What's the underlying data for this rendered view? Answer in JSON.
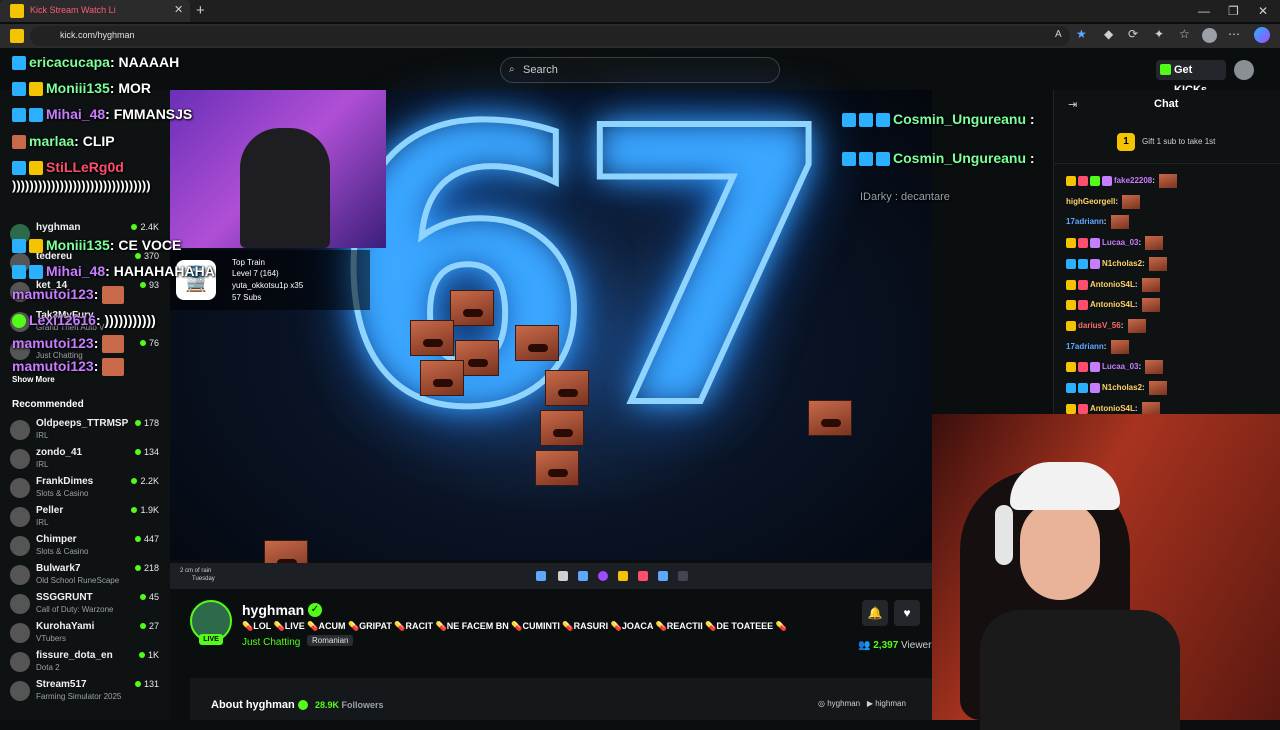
{
  "browser": {
    "tab_title": "Kick Stream Watch Li",
    "url": "kick.com/hyghman",
    "new_tab": "+",
    "window_min": "—",
    "window_max": "❐",
    "window_close": "✕"
  },
  "header": {
    "search_placeholder": "Search",
    "get_kicks": "Get KICKs",
    "brand_color": "#53fc18"
  },
  "sidebar": {
    "followed": [
      {
        "name": "hyghman",
        "category": "Just Chatting",
        "viewers": "2.4K"
      },
      {
        "name": "tedereu",
        "category": "",
        "viewers": "370"
      },
      {
        "name": "ket_14",
        "category": "",
        "viewers": "93"
      },
      {
        "name": "Tak3MyFury",
        "category": "Grand Theft Auto V",
        "viewers": "76"
      },
      {
        "name": "",
        "category": "Just Chatting",
        "viewers": "76"
      }
    ],
    "show_more": "Show More",
    "recommended_title": "Recommended",
    "recommended": [
      {
        "name": "Oldpeeps_TTRMSP",
        "category": "IRL",
        "viewers": "178"
      },
      {
        "name": "zondo_41",
        "category": "IRL",
        "viewers": "134"
      },
      {
        "name": "FrankDimes",
        "category": "Slots & Casino",
        "viewers": "2.2K"
      },
      {
        "name": "Peller",
        "category": "IRL",
        "viewers": "1.9K"
      },
      {
        "name": "Chimper",
        "category": "Slots & Casino",
        "viewers": "447"
      },
      {
        "name": "Bulwark7",
        "category": "Old School RuneScape",
        "viewers": "218"
      },
      {
        "name": "SSGGRUNT",
        "category": "Call of Duty: Warzone",
        "viewers": "45"
      },
      {
        "name": "KurohaYami",
        "category": "VTubers",
        "viewers": "27"
      },
      {
        "name": "fissure_dota_en",
        "category": "Dota 2",
        "viewers": "1K"
      },
      {
        "name": "Stream517",
        "category": "Farming Simulator 2025",
        "viewers": "131"
      }
    ]
  },
  "overlay_chat": [
    {
      "user": "ericacucapa",
      "msg": "NAAAAH"
    },
    {
      "user": "Moniii135",
      "msg": "MOR"
    },
    {
      "user": "Mihai_48",
      "msg": "FMMANSJS"
    },
    {
      "user": "marlaa",
      "msg": "CLIP"
    },
    {
      "user": "StiLLeRg0d",
      "msg": "))))))))))))))))))))))))))))))))"
    },
    {
      "user": "Moniii135",
      "msg": "CE VOCE"
    },
    {
      "user": "Mihai_48",
      "msg": "HAHAHAHAHA"
    },
    {
      "user": "mamutoi123",
      "msg": ""
    },
    {
      "user": "Lexi12616",
      "msg": ")))))))))))"
    },
    {
      "user": "mamutoi123",
      "msg": ""
    },
    {
      "user": "mamutoi123",
      "msg": ""
    }
  ],
  "overlay_right": [
    {
      "user": "Cosmin_Ungureanu",
      "msg": ""
    },
    {
      "user": "Cosmin_Ungureanu",
      "msg": ""
    },
    {
      "user": "IDarky",
      "msg": "decantare"
    }
  ],
  "video_overlay": {
    "big_number": "67",
    "top_train": "Top Train",
    "train_level": "Level 7 (164)",
    "train_user": "yuta_okkotsu1p x35",
    "train_subs": "57 Subs",
    "rain_text": "2 cm of rain",
    "rain_day": "Tuesday"
  },
  "stream": {
    "streamer": "hyghman",
    "live": "LIVE",
    "title": "💊LOL 💊LIVE 💊ACUM 💊GRIPAT 💊RACIT 💊NE FACEM BN 💊CUMINTI 💊RASURI 💊JOACA 💊REACTII 💊DE TOATEEE 💊",
    "category": "Just Chatting",
    "language": "Romanian",
    "viewers": "2,397",
    "viewers_label": "Viewers",
    "about": "About hyghman",
    "followers": "28.9K",
    "followers_label": "Followers",
    "social_instagram": "hyghman",
    "social_youtube": "highman"
  },
  "chat": {
    "title": "Chat",
    "gift_text": "Gift 1 sub to take 1st",
    "gift_rank": "1",
    "messages": [
      {
        "user": "fake22208",
        "color": "#c77dff"
      },
      {
        "user": "highGeorgell",
        "color": "#ffd166"
      },
      {
        "user": "17adriann",
        "color": "#5fa8ff"
      },
      {
        "user": "Lucaa_03",
        "color": "#c77dff"
      },
      {
        "user": "N1cholas2",
        "color": "#ffd166"
      },
      {
        "user": "AntonioS4L",
        "color": "#ffd166"
      },
      {
        "user": "AntonioS4L",
        "color": "#ffd166"
      },
      {
        "user": "dariusV_56",
        "color": "#ff6b6b"
      },
      {
        "user": "17adriann",
        "color": "#5fa8ff"
      },
      {
        "user": "Lucaa_03",
        "color": "#c77dff"
      },
      {
        "user": "N1cholas2",
        "color": "#ffd166"
      },
      {
        "user": "AntonioS4L",
        "color": "#ffd166"
      }
    ]
  }
}
